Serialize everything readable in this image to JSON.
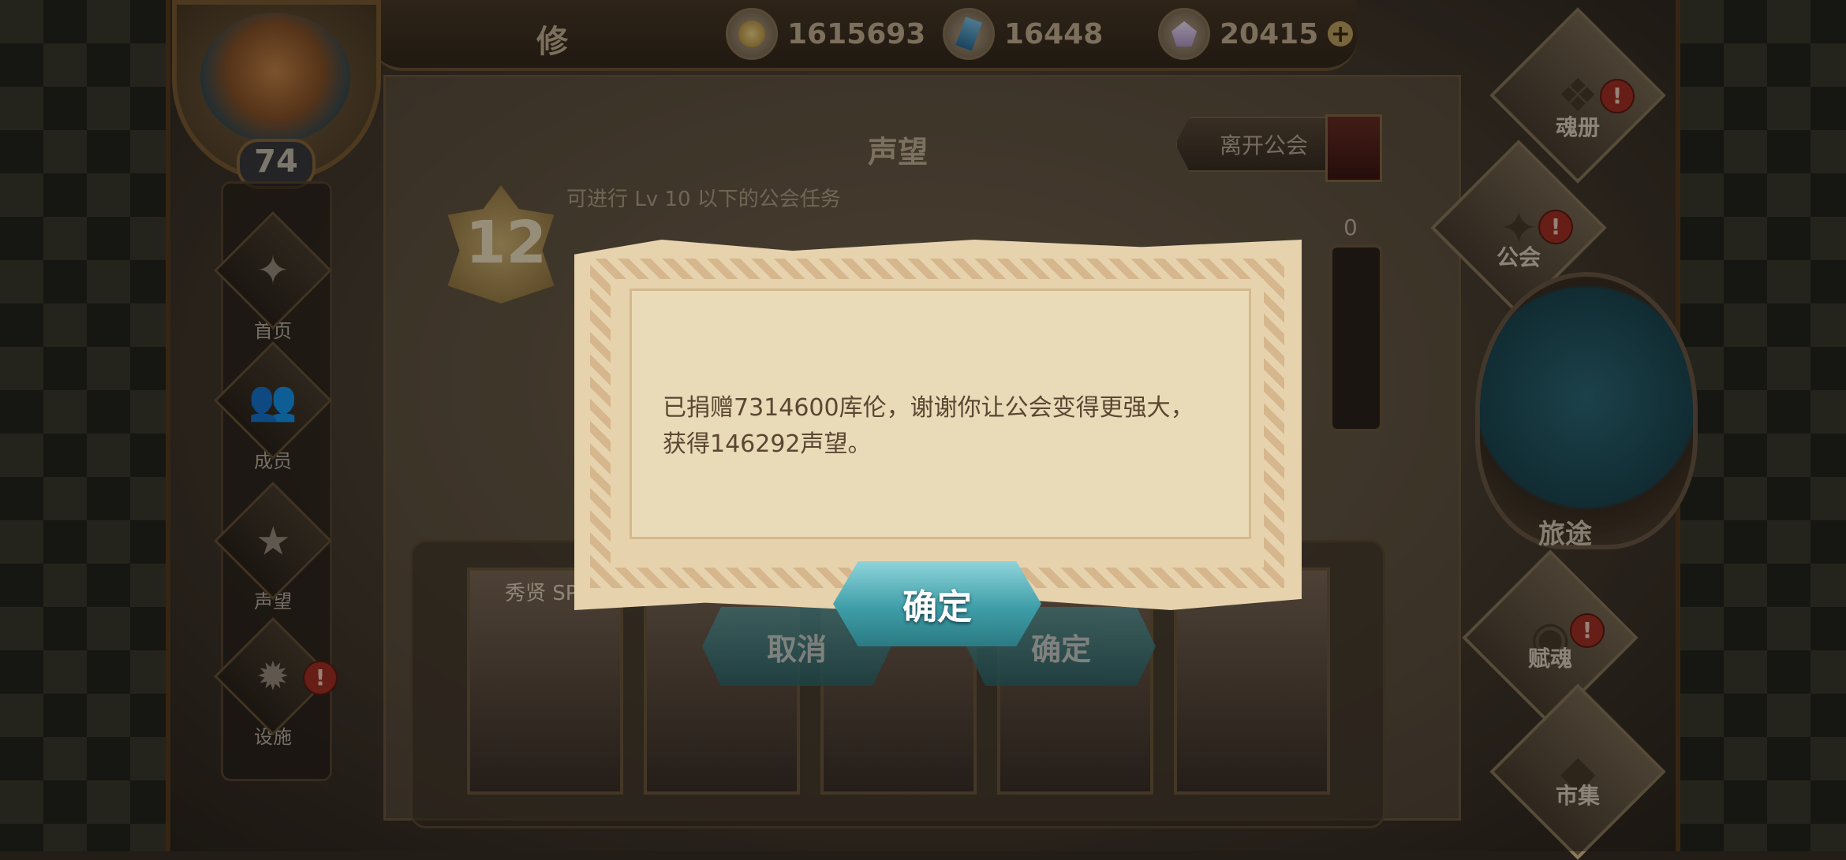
{
  "player": {
    "name": "修",
    "level": "74"
  },
  "currency": [
    {
      "icon": "gold-coin-icon",
      "value": "1615693"
    },
    {
      "icon": "blue-gem-icon",
      "value": "16448"
    },
    {
      "icon": "crystal-icon",
      "value": "20415",
      "add": "+"
    }
  ],
  "left_nav": [
    {
      "label": "首页",
      "icon": "guild-emblem-icon"
    },
    {
      "label": "成员",
      "icon": "members-icon"
    },
    {
      "label": "声望",
      "icon": "reputation-icon"
    },
    {
      "label": "设施",
      "icon": "facility-icon",
      "badge": "!"
    }
  ],
  "right_nav": [
    {
      "label": "魂册",
      "icon": "soul-book-icon",
      "badge": "!"
    },
    {
      "label": "公会",
      "icon": "guild-icon",
      "badge": "!"
    },
    {
      "label": "旅途",
      "icon": "journey-icon"
    },
    {
      "label": "赋魂",
      "icon": "soul-infuse-icon",
      "badge": "!"
    },
    {
      "label": "市集",
      "icon": "market-icon"
    }
  ],
  "panel": {
    "title": "声望",
    "leave_button": "离开公会",
    "hint": "可进行 Lv 10 以下的公会任务",
    "rank": "12",
    "gauge_value": "0",
    "card_name": "秀贤 SP",
    "cancel_label": "取消",
    "confirm_label": "确定"
  },
  "modal": {
    "message": "已捐赠7314600库伦，谢谢你让公会变得更强大，获得146292声望。",
    "confirm_label": "确定"
  },
  "colors": {
    "accent_button": "#3e9ea8",
    "badge": "#a63125",
    "parchment": "#e6d3ae"
  }
}
